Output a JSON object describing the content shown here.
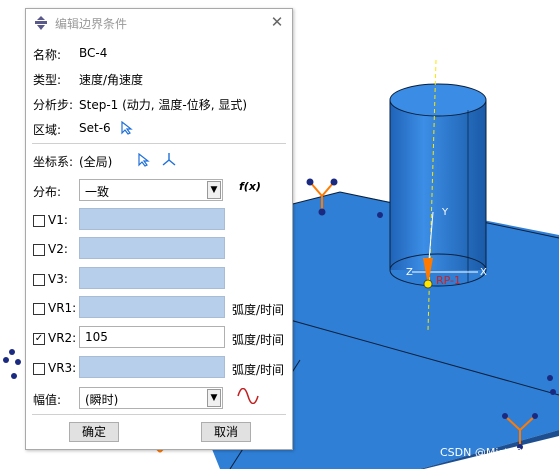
{
  "dialog": {
    "title": "编辑边界条件",
    "name_label": "名称:",
    "name_value": "BC-4",
    "type_label": "类型:",
    "type_value": "速度/角速度",
    "step_label": "分析步:",
    "step_value": "Step-1 (动力, 温度-位移, 显式)",
    "region_label": "区域:",
    "region_value": "Set-6",
    "csys_label": "坐标系:",
    "csys_value": "(全局)",
    "distribution_label": "分布:",
    "distribution_value": "一致",
    "fx_label": "f(x)",
    "fields": [
      {
        "label": "V1:",
        "checked": false,
        "value": "",
        "unit": ""
      },
      {
        "label": "V2:",
        "checked": false,
        "value": "",
        "unit": ""
      },
      {
        "label": "V3:",
        "checked": false,
        "value": "",
        "unit": ""
      },
      {
        "label": "VR1:",
        "checked": false,
        "value": "",
        "unit": "弧度/时间"
      },
      {
        "label": "VR2:",
        "checked": true,
        "value": "105",
        "unit": "弧度/时间"
      },
      {
        "label": "VR3:",
        "checked": false,
        "value": "",
        "unit": "弧度/时间"
      }
    ],
    "amplitude_label": "幅值:",
    "amplitude_value": "(瞬时)",
    "ok_label": "确定",
    "cancel_label": "取消"
  },
  "viewport": {
    "axis_x": "X",
    "axis_y": "Y",
    "axis_z": "Z",
    "rp_label": "RP-1",
    "watermark": "CSDN @Mist_Orz",
    "model_color": "#2f7fd6"
  }
}
